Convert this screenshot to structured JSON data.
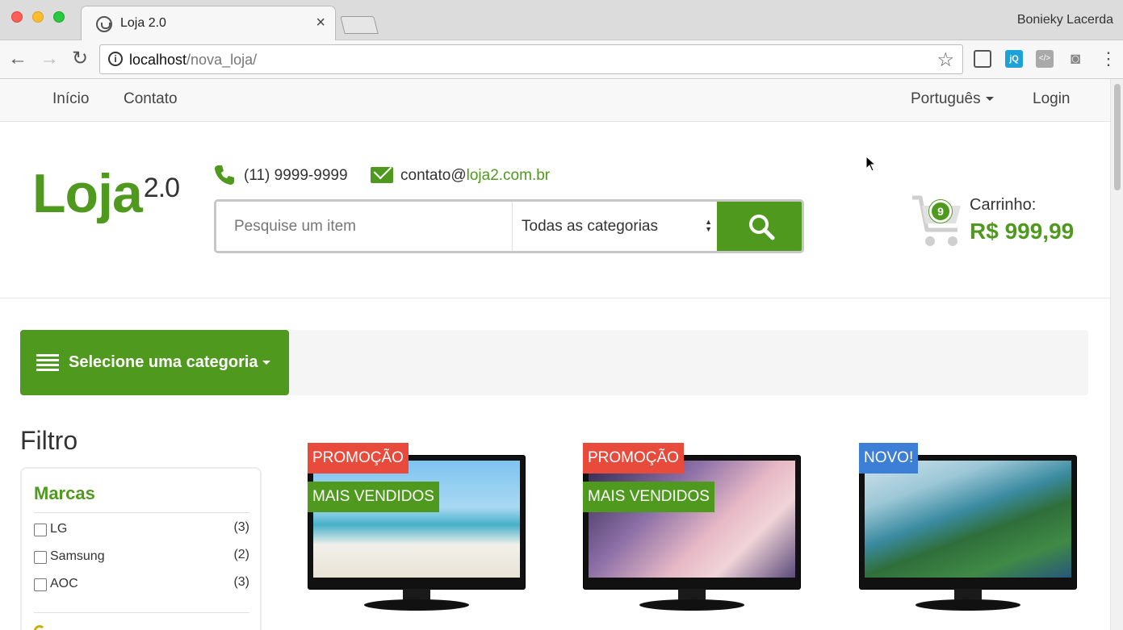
{
  "browser": {
    "tab_title": "Loja 2.0",
    "tab_close": "×",
    "profile_name": "Bonieky Lacerda",
    "url_host": "localhost",
    "url_path": "/nova_loja/",
    "ext_jq_label": "jQ",
    "ext_code_label": "</>"
  },
  "topnav": {
    "items": [
      {
        "label": "Início"
      },
      {
        "label": "Contato"
      }
    ],
    "language": "Português",
    "login": "Login"
  },
  "header": {
    "logo_main": "Loja",
    "logo_version": "2.0",
    "phone": "(11) 9999-9999",
    "email_user": "contato@",
    "email_domain": "loja2.com.br"
  },
  "search": {
    "placeholder": "Pesquise um item",
    "category_selected": "Todas as categorias"
  },
  "cart": {
    "count": "9",
    "label": "Carrinho:",
    "total": "R$ 999,99"
  },
  "category_bar": {
    "label": "Selecione uma categoria"
  },
  "filter": {
    "title": "Filtro",
    "brands_title": "Marcas",
    "brands": [
      {
        "name": "LG",
        "count": "(3)"
      },
      {
        "name": "Samsung",
        "count": "(2)"
      },
      {
        "name": "AOC",
        "count": "(3)"
      }
    ]
  },
  "products": [
    {
      "tags": [
        "PROMOÇÃO",
        "MAIS VENDIDOS"
      ]
    },
    {
      "tags": [
        "PROMOÇÃO",
        "MAIS VENDIDOS"
      ]
    },
    {
      "tags": [
        "NOVO!"
      ]
    }
  ],
  "colors": {
    "brand_green": "#4f9a1e",
    "promo_red": "#e84b3c",
    "new_blue": "#3d7fd6"
  }
}
